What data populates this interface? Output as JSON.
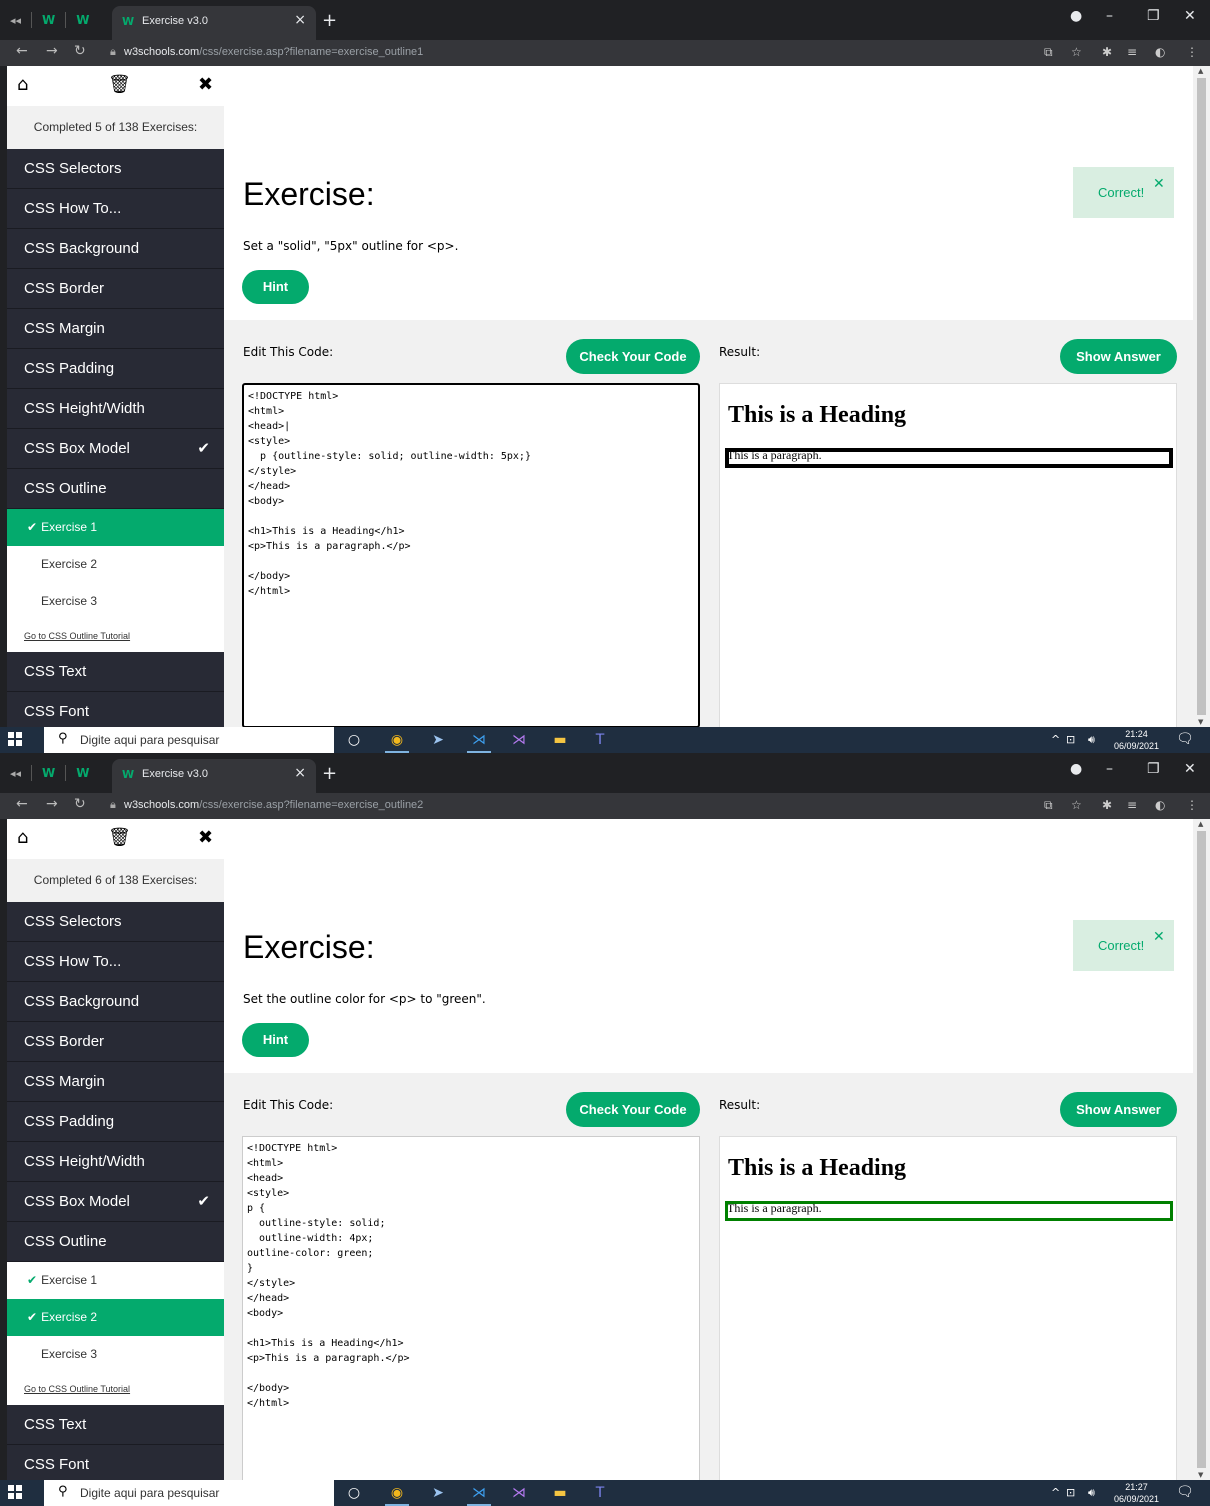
{
  "browser": {
    "tab_title": "Exercise v3.0",
    "host": "w3schools.com",
    "new_tab": "+",
    "tab_close": "×"
  },
  "shared": {
    "exercise_heading": "Exercise:",
    "hint_label": "Hint",
    "correct_label": "Correct!",
    "edit_label": "Edit This Code:",
    "check_label": "Check Your Code",
    "result_label": "Result:",
    "answer_label": "Show Answer",
    "result_heading": "This is a Heading",
    "result_paragraph": "This is a paragraph.",
    "menu_items": [
      "CSS Selectors",
      "CSS How To...",
      "CSS Background",
      "CSS Border",
      "CSS Margin",
      "CSS Padding",
      "CSS Height/Width",
      "CSS Box Model",
      "CSS Outline"
    ],
    "menu_after": [
      "CSS Text",
      "CSS Font"
    ],
    "sub_items": [
      "Exercise 1",
      "Exercise 2",
      "Exercise 3"
    ],
    "tutorial_link": "Go to CSS Outline Tutorial",
    "taskbar_search": "Digite aqui para pesquisar"
  },
  "screens": [
    {
      "url_path": "/css/exercise.asp?filename=exercise_outline1",
      "completed": "Completed 5 of 138 Exercises:",
      "description": "Set a \"solid\", \"5px\" outline for <p>.",
      "code": "<!DOCTYPE html>\n<html>\n<head>|\n<style>\n  p {outline-style: solid; outline-width: 5px;}\n</style>\n</head>\n<body>\n\n<h1>This is a Heading</h1>\n<p>This is a paragraph.</p>\n\n</body>\n</html>",
      "active_exercise": 0,
      "outline_color": "#000000",
      "outline_width": 4,
      "clock_time": "21:24",
      "clock_date": "06/09/2021"
    },
    {
      "url_path": "/css/exercise.asp?filename=exercise_outline2",
      "completed": "Completed 6 of 138 Exercises:",
      "description": "Set the outline color for <p> to \"green\".",
      "code": "<!DOCTYPE html>\n<html>\n<head>\n<style>\np {\n  outline-style: solid;\n  outline-width: 4px;\noutline-color: green;\n}\n</style>\n</head>\n<body>\n\n<h1>This is a Heading</h1>\n<p>This is a paragraph.</p>\n\n</body>\n</html>",
      "active_exercise": 1,
      "outline_color": "#008000",
      "outline_width": 3,
      "clock_time": "21:27",
      "clock_date": "06/09/2021"
    }
  ],
  "colors": {
    "accent": "#04aa6d",
    "sidebar_bg": "#282a35",
    "correct_bg": "#d9eee1"
  }
}
